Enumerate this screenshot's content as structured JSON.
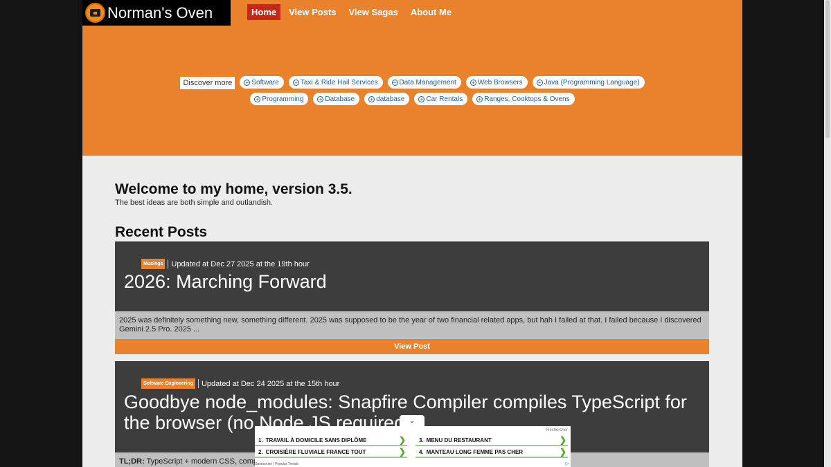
{
  "site": {
    "name": "Norman's Oven"
  },
  "nav": [
    {
      "label": "Home",
      "active": true
    },
    {
      "label": "View Posts",
      "active": false
    },
    {
      "label": "View Sagas",
      "active": false
    },
    {
      "label": "About Me",
      "active": false
    }
  ],
  "topics": {
    "discover_label": "Discover more",
    "row1": [
      "Software",
      "Taxi & Ride Hail Services",
      "Data Management",
      "Web Browsers",
      "Java (Programming Language)"
    ],
    "row2": [
      "Programming",
      "Database",
      "database",
      "Car Rentals",
      "Ranges, Cooktops & Ovens"
    ]
  },
  "welcome": {
    "heading": "Welcome to my home, version 3.5.",
    "tagline": "The best ideas are both simple and outlandish."
  },
  "recent": {
    "heading": "Recent Posts",
    "posts": [
      {
        "tag": "Musings",
        "updated": "Updated at Dec 27 2025 at the 19th hour",
        "title": "2026: Marching Forward",
        "excerpt": "2025 was definitely something new, something different. 2025 was supposed to be the year of two financial related apps, but hah I failed at that. I failed because I discovered Gemini 2.5 Pro. 2025 ...",
        "button": "View Post"
      },
      {
        "tag": "Software Engineering",
        "updated": "Updated at Dec 24 2025 at the 15th hour",
        "title_line1": "Goodbye node_modules: Snapfire Compiler compiles TypeScript for",
        "title_line2": "the browser (no Node JS required",
        "excerpt_bold": "TL;DR:",
        "excerpt": " TypeScript + modern CSS, compil"
      }
    ]
  },
  "ad": {
    "search_label": "Rechercher",
    "items": [
      {
        "num": "1.",
        "label": "TRAVAIL À DOMICILE SANS DIPLÔME"
      },
      {
        "num": "2.",
        "label": "CROISIÈRE FLUVIALE FRANCE TOUT"
      },
      {
        "num": "3.",
        "label": "MENU DU RESTAURANT"
      },
      {
        "num": "4.",
        "label": "MANTEAU LONG FEMME PAS CHER"
      }
    ],
    "footer": "Sponsorisé | Popular Trends",
    "arrow_glyph": "❯",
    "collapse_glyph": "⌄",
    "logo_glyph": "▷"
  }
}
